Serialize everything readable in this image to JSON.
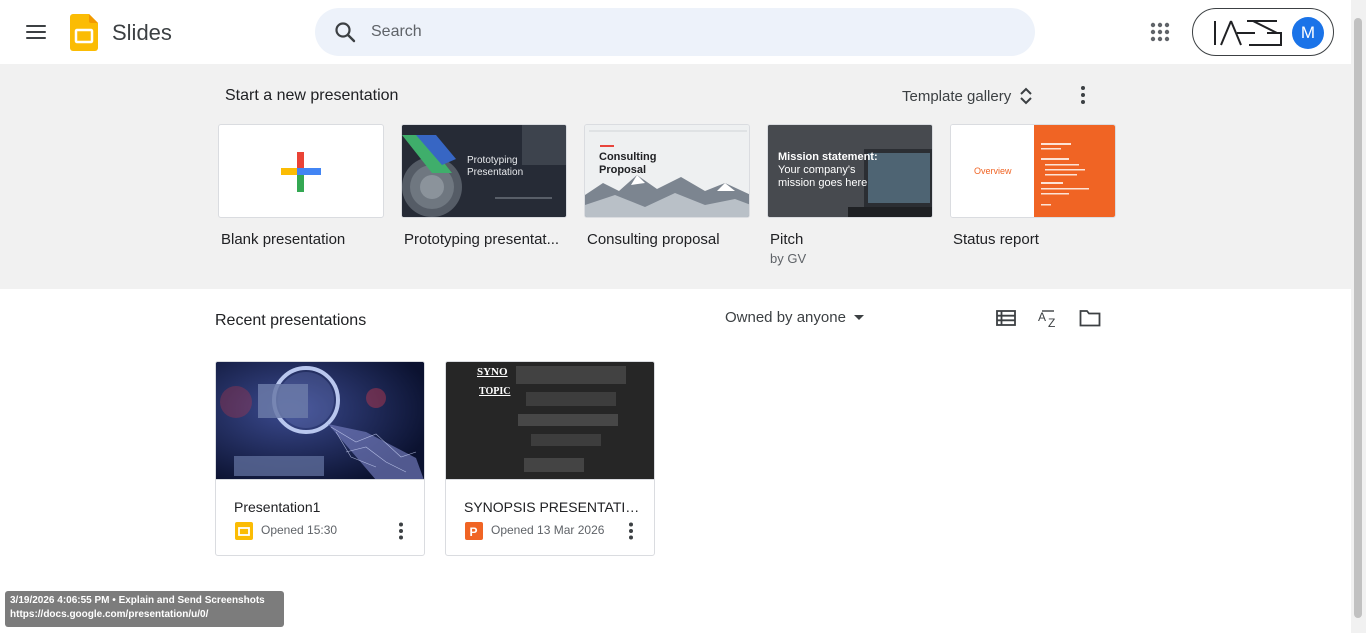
{
  "header": {
    "app_name": "Slides",
    "search_placeholder": "Search",
    "account_initial": "M",
    "icons": {
      "menu": "hamburger-menu-icon",
      "logo": "slides-logo-icon",
      "search": "search-icon",
      "apps": "apps-grid-icon"
    }
  },
  "templates": {
    "title": "Start a new presentation",
    "gallery_label": "Template gallery",
    "items": [
      {
        "label": "Blank presentation",
        "sub": ""
      },
      {
        "label": "Prototyping presentat...",
        "sub": "",
        "thumb_title": "Prototyping Presentation"
      },
      {
        "label": "Consulting proposal",
        "sub": "",
        "thumb_title": "Consulting Proposal"
      },
      {
        "label": "Pitch",
        "sub": "by GV",
        "thumb_title": "Mission statement:",
        "thumb_body": "Your company's mission goes here"
      },
      {
        "label": "Status report",
        "sub": "",
        "thumb_title": "Overview"
      }
    ]
  },
  "recent": {
    "title": "Recent presentations",
    "owner_filter": "Owned by anyone",
    "docs": [
      {
        "name": "Presentation1",
        "meta": "Opened 15:30",
        "type": "slides"
      },
      {
        "name": "SYNOPSIS PRESENTATIO...",
        "meta": "Opened 13 Mar 2026",
        "type": "powerpoint",
        "thumb_line1": "SYNO",
        "thumb_line2": "TOPIC"
      }
    ]
  },
  "overlay": {
    "line1": "3/19/2026 4:06:55 PM • Explain and Send Screenshots",
    "line2": "https://docs.google.com/presentation/u/0/"
  },
  "colors": {
    "accent": "#1a73e8",
    "slides_yellow": "#fbbc04",
    "status_orange": "#f06424",
    "search_bg": "#edf2fa"
  }
}
